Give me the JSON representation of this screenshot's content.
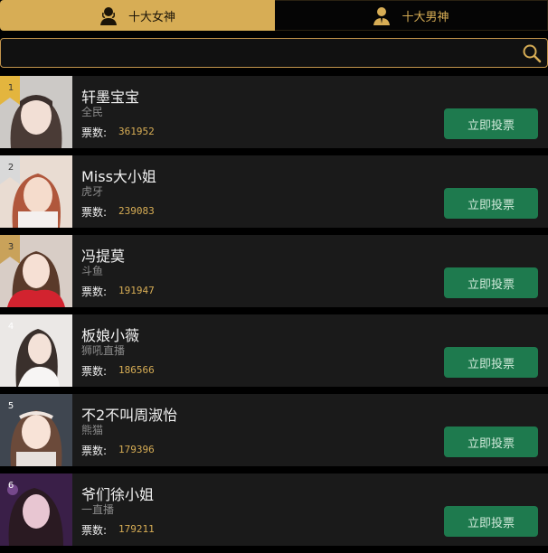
{
  "tabs": [
    {
      "label": "十大女神",
      "icon": "female-user-icon",
      "active": true
    },
    {
      "label": "十大男神",
      "icon": "male-user-icon",
      "active": false
    }
  ],
  "search": {
    "value": "",
    "placeholder": "",
    "icon": "search-icon"
  },
  "vote_label": "票数:",
  "vote_button_label": "立即投票",
  "colors": {
    "accent": "#d7ad55",
    "button": "#1e7a4e",
    "row_bg": "#1a1a1a",
    "background": "#000000"
  },
  "rows": [
    {
      "rank": "1",
      "name": "轩墨宝宝",
      "platform": "全民",
      "votes": "361952",
      "badge_color": "#e3b53e"
    },
    {
      "rank": "2",
      "name": "Miss大小姐",
      "platform": "虎牙",
      "votes": "239083",
      "badge_color": "#d9d9d9"
    },
    {
      "rank": "3",
      "name": "冯提莫",
      "platform": "斗鱼",
      "votes": "191947",
      "badge_color": "#c9a25a"
    },
    {
      "rank": "4",
      "name": "板娘小薇",
      "platform": "狮吼直播",
      "votes": "186566",
      "badge_color": ""
    },
    {
      "rank": "5",
      "name": "不2不叫周淑怡",
      "platform": "熊猫",
      "votes": "179396",
      "badge_color": ""
    },
    {
      "rank": "6",
      "name": "爷们徐小姐",
      "platform": "一直播",
      "votes": "179211",
      "badge_color": ""
    }
  ]
}
